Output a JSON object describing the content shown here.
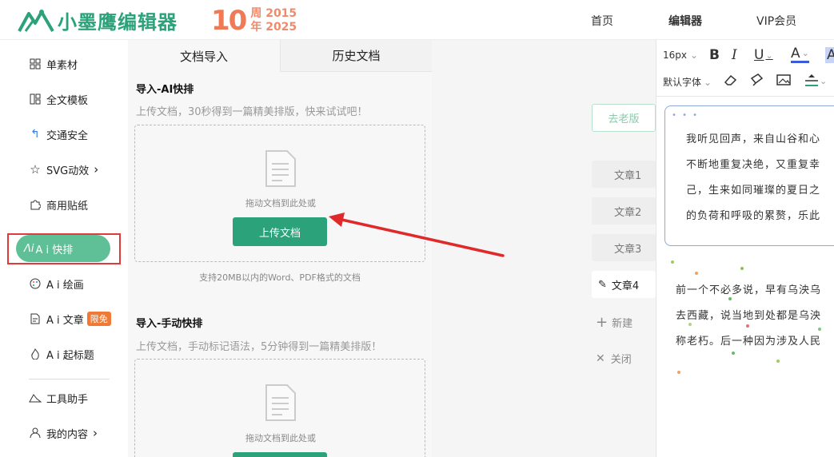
{
  "brand": {
    "name": "小墨鹰编辑器",
    "anniv_big": "10",
    "anniv_line1": "周 2015",
    "anniv_line2": "年 2025",
    "color": "#2ba27a"
  },
  "nav": {
    "home": "首页",
    "editor": "编辑器",
    "vip": "VIP会员"
  },
  "sidebar": {
    "items": [
      {
        "label": "单素材",
        "icon": "grid-icon"
      },
      {
        "label": "全文模板",
        "icon": "template-icon"
      },
      {
        "label": "交通安全",
        "icon": "arrow-up-left-icon"
      },
      {
        "label": "SVG动效",
        "icon": "star-icon",
        "chevron": "›"
      },
      {
        "label": "商用贴纸",
        "icon": "puzzle-icon"
      },
      {
        "label": "A i 快排",
        "icon": "ai-icon"
      },
      {
        "label": "A i 绘画",
        "icon": "palette-icon"
      },
      {
        "label": "A i 文章",
        "icon": "doc-edit-icon",
        "badge": "限免"
      },
      {
        "label": "A i 起标题",
        "icon": "fire-icon"
      },
      {
        "label": "工具助手",
        "icon": "tools-icon"
      },
      {
        "label": "我的内容",
        "icon": "user-icon",
        "chevron": "›"
      }
    ],
    "active_label": "Ai A i 快排"
  },
  "panel": {
    "tabs": [
      "文档导入",
      "历史文档"
    ],
    "ai": {
      "title": "导入-AI快排",
      "desc": "上传文档，30秒得到一篇精美排版，快来试试吧！",
      "drop_text": "拖动文档到此处或",
      "button": "上传文档",
      "support": "支持20MB以内的Word、PDF格式的文档"
    },
    "manual": {
      "title": "导入-手动快排",
      "desc": "上传文档，手动标记语法，5分钟得到一篇精美排版！",
      "drop_text": "拖动文档到此处或"
    }
  },
  "canvas": {
    "old_button": "去老版",
    "articles": [
      "文章1",
      "文章2",
      "文章3",
      "文章4"
    ],
    "new_label": "新建",
    "close_label": "关闭"
  },
  "toolbar": {
    "font_size": "16px",
    "font_family": "默认字体",
    "accent": "#3b5bdb"
  },
  "editor": {
    "block_lines": [
      "我听见回声，来自山谷和心",
      "不断地重复决绝，又重复幸",
      "己，生来如同璀璨的夏日之",
      "的负荷和呼吸的累赘，乐此"
    ],
    "body_lines": [
      "前一个不必多说，早有乌泱乌",
      "去西藏，说当地到处都是乌泱",
      "称老朽。后一种因为涉及人民"
    ]
  }
}
